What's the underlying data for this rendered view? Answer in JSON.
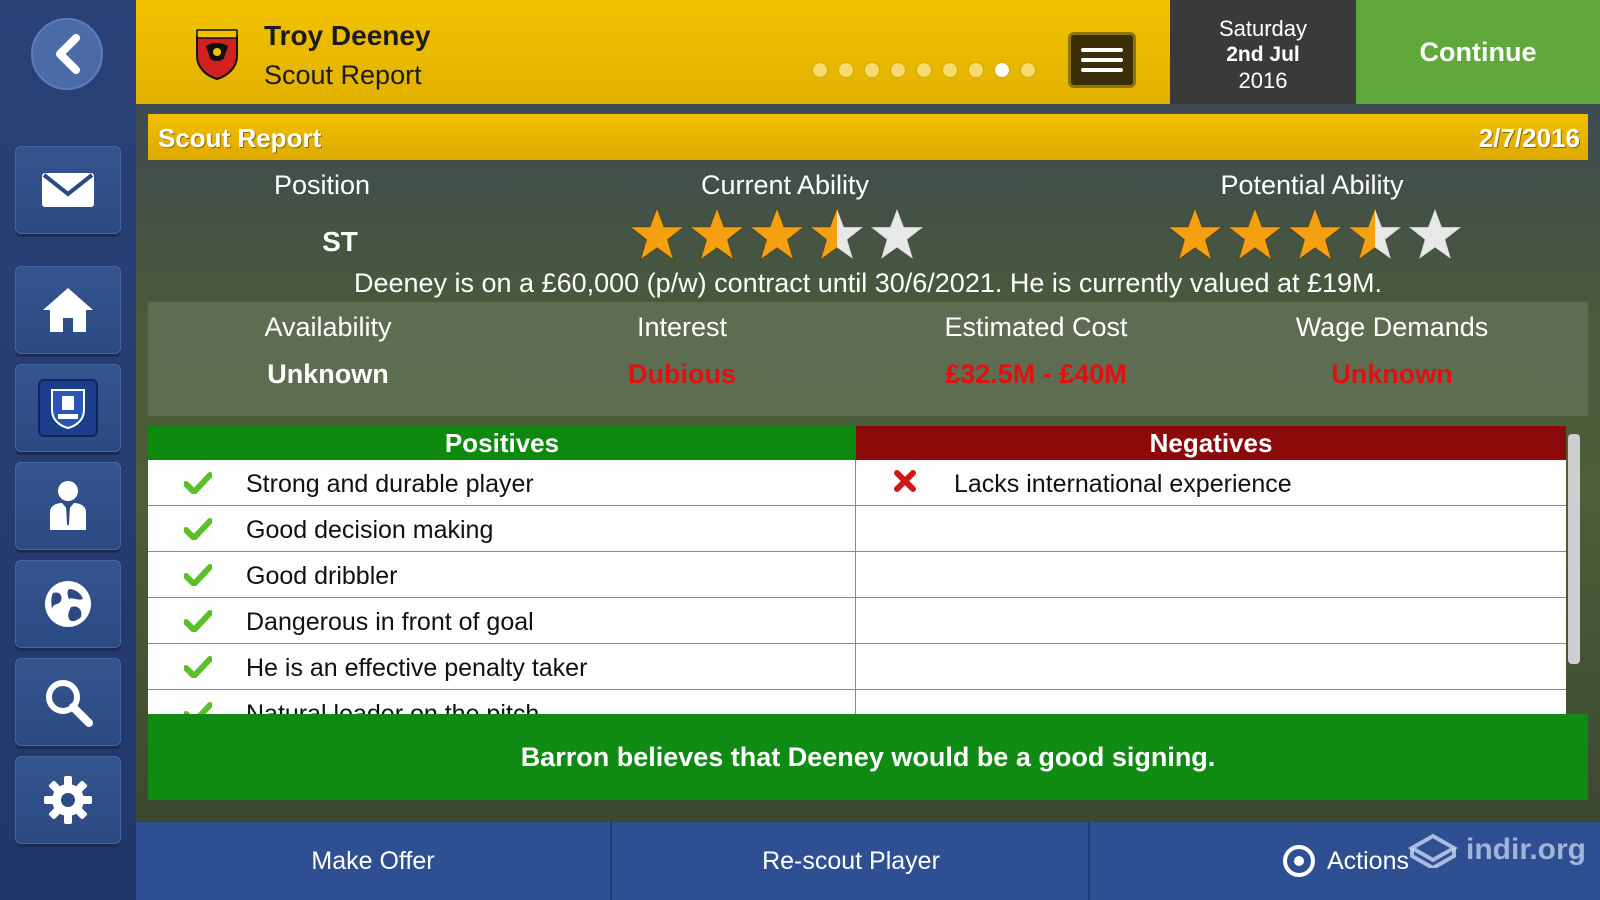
{
  "header": {
    "player_name": "Troy Deeney",
    "subtitle": "Scout Report",
    "pager": {
      "count": 9,
      "active_index": 7
    },
    "date": {
      "weekday": "Saturday",
      "day_month": "2nd Jul",
      "year": "2016"
    },
    "continue_label": "Continue"
  },
  "sidebar": {
    "items": [
      {
        "name": "mail"
      },
      {
        "name": "home"
      },
      {
        "name": "club"
      },
      {
        "name": "staff"
      },
      {
        "name": "world"
      },
      {
        "name": "search"
      },
      {
        "name": "settings"
      }
    ]
  },
  "report": {
    "title": "Scout Report",
    "date": "2/7/2016",
    "position_label": "Position",
    "position_value": "ST",
    "current_ability_label": "Current Ability",
    "current_ability_stars": 3.5,
    "potential_ability_label": "Potential Ability",
    "potential_ability_stars": 3.5,
    "max_stars": 5,
    "contract_text": "Deeney is on a £60,000 (p/w) contract until 30/6/2021. He is currently valued at £19M.",
    "info": [
      {
        "label": "Availability",
        "value": "Unknown",
        "color": "#ffffff"
      },
      {
        "label": "Interest",
        "value": "Dubious",
        "color": "#e01010"
      },
      {
        "label": "Estimated Cost",
        "value": "£32.5M - £40M",
        "color": "#e01010"
      },
      {
        "label": "Wage Demands",
        "value": "Unknown",
        "color": "#e01010"
      }
    ],
    "positives_header": "Positives",
    "negatives_header": "Negatives",
    "positives": [
      "Strong and durable player",
      "Good decision making",
      "Good dribbler",
      "Dangerous in front of goal",
      "He is an effective penalty taker",
      "Natural leader on the pitch"
    ],
    "negatives": [
      "Lacks international experience"
    ],
    "verdict": "Barron believes that Deeney would be a good signing."
  },
  "bottom": {
    "make_offer": "Make Offer",
    "rescout": "Re-scout Player",
    "actions": "Actions",
    "watermark": "indir.org"
  },
  "colors": {
    "header_yellow": "#f2c200",
    "continue_green": "#5fa83a",
    "positive_green": "#0d8a0d",
    "negative_red": "#8c0a0a",
    "star_gold": "#f4a010"
  }
}
